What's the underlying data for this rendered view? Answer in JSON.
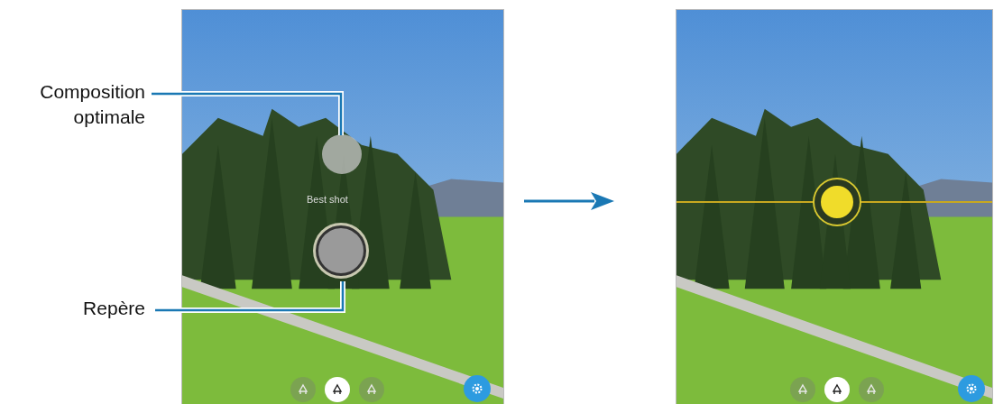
{
  "callouts": [
    {
      "label": "Composition optimale"
    },
    {
      "label": "Repère"
    }
  ],
  "screens": [
    {
      "kind": "before",
      "best_shot_label": "Best shot",
      "lens_options": [
        {
          "selected": false
        },
        {
          "selected": true
        },
        {
          "selected": false
        }
      ]
    },
    {
      "kind": "after",
      "lens_options": [
        {
          "selected": false
        },
        {
          "selected": true
        },
        {
          "selected": false
        }
      ]
    }
  ]
}
